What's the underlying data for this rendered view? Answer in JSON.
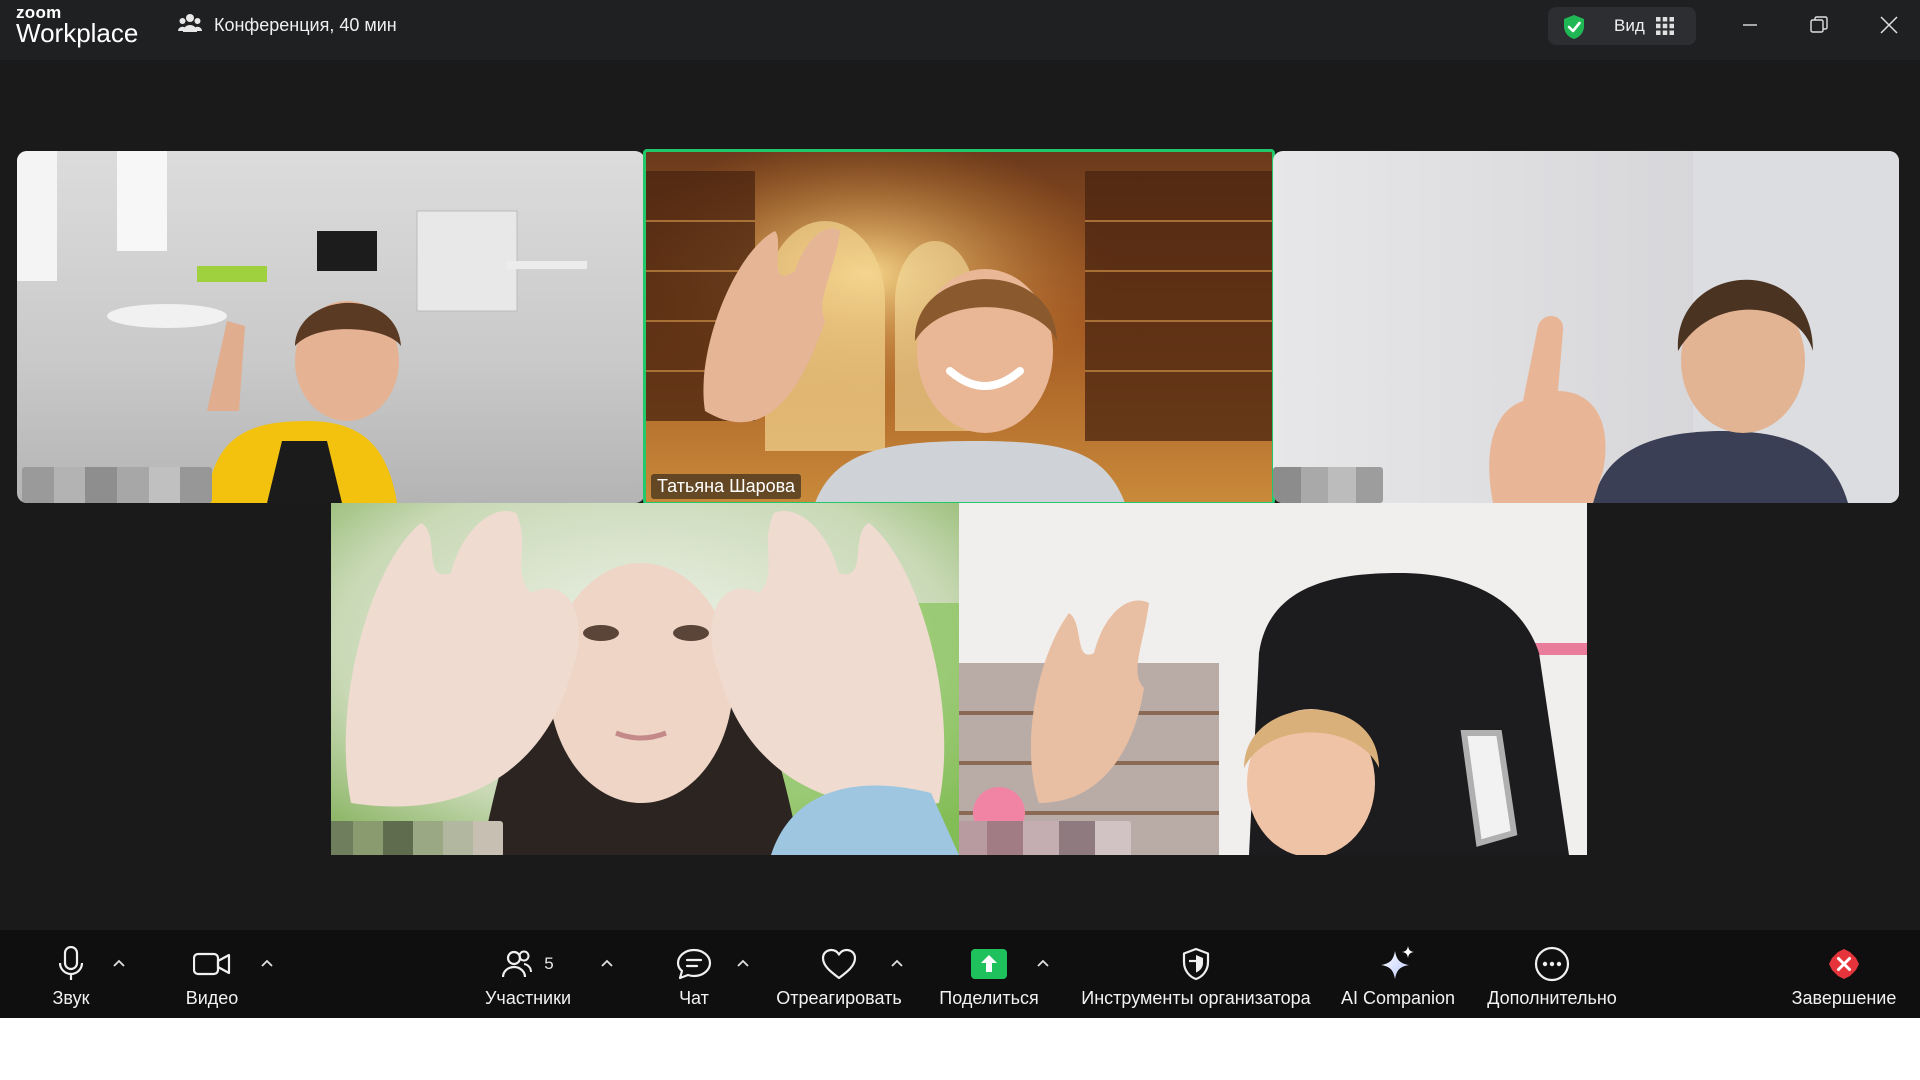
{
  "app": {
    "logo_top": "zoom",
    "logo_bottom": "Workplace",
    "meeting_title": "Конференция, 40 мин",
    "view_label": "Вид"
  },
  "participants": {
    "active_speaker_name": "Татьяна Шарова"
  },
  "toolbar": {
    "audio": "Звук",
    "video": "Видео",
    "participants": "Участники",
    "participants_count": "5",
    "chat": "Чат",
    "react": "Отреагировать",
    "share": "Поделиться",
    "host_tools": "Инструменты организатора",
    "ai_companion": "AI Companion",
    "more": "Дополнительно",
    "end": "Завершение"
  },
  "colors": {
    "active_speaker_border": "#21c96b",
    "share_button": "#1fc15d",
    "end_button": "#e5343c",
    "secure_shield": "#1fb855"
  }
}
